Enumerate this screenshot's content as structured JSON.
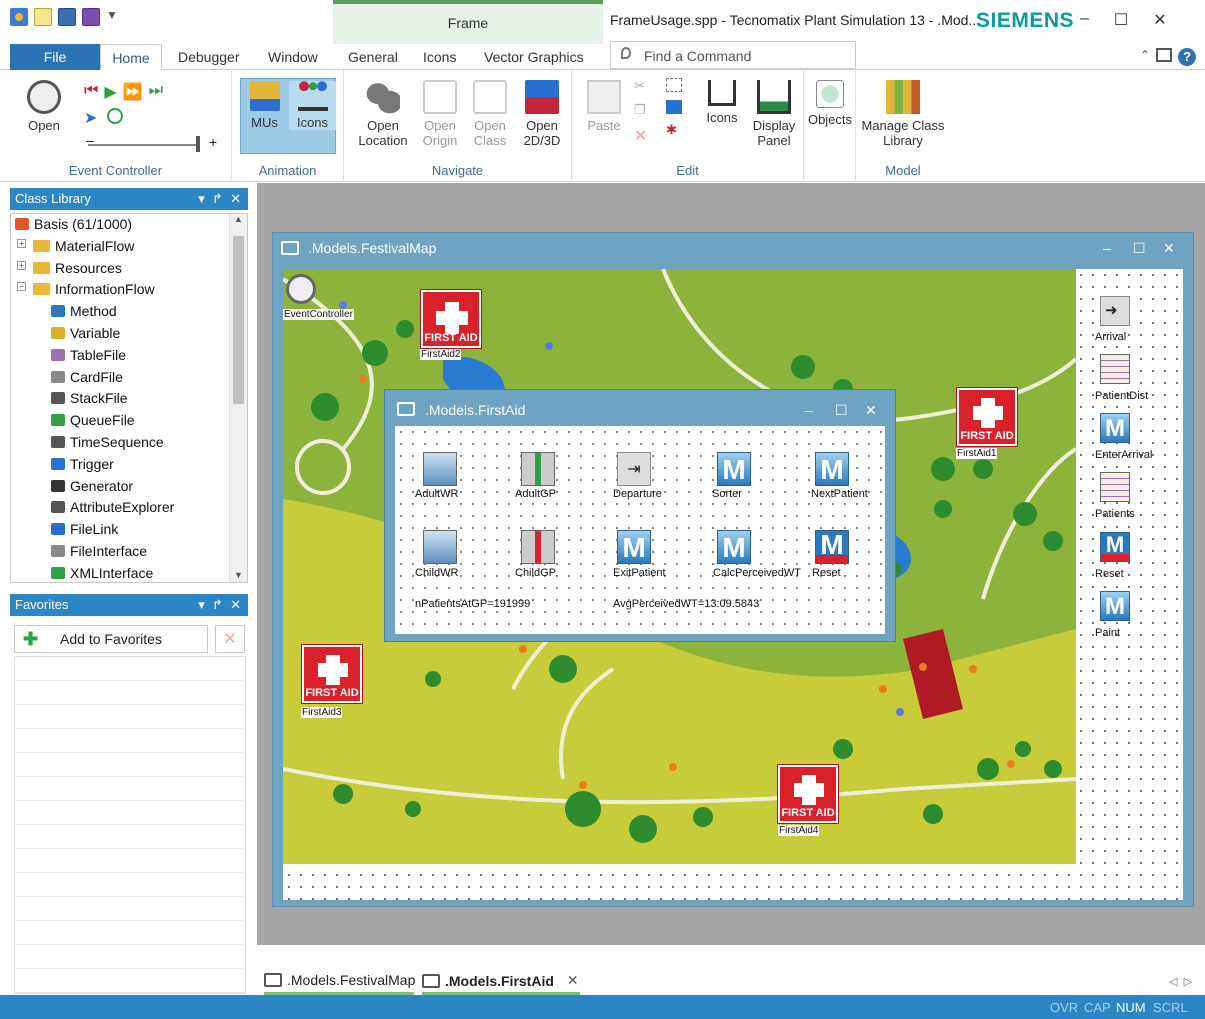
{
  "app": {
    "context_tab": "Frame",
    "window_title": "FrameUsage.spp - Tecnomatix Plant Simulation 13 - .Mod...",
    "brand": "SIEMENS"
  },
  "menu": {
    "file": "File",
    "tabs": [
      "Home",
      "Debugger",
      "Window",
      "General",
      "Icons",
      "Vector Graphics"
    ],
    "search_placeholder": "Find a Command"
  },
  "ribbon": {
    "event_controller": {
      "label": "Event Controller",
      "open": "Open"
    },
    "animation": {
      "label": "Animation",
      "mus": "MUs",
      "icons": "Icons"
    },
    "navigate": {
      "label": "Navigate",
      "open_location": "Open Location",
      "open_origin": "Open Origin",
      "open_class": "Open Class",
      "open_2d3d": "Open 2D/3D"
    },
    "edit": {
      "label": "Edit",
      "paste": "Paste",
      "icons": "Icons",
      "display_panel": "Display Panel",
      "objects": "Objects"
    },
    "model": {
      "label": "Model",
      "manage": "Manage Class Library"
    }
  },
  "class_library": {
    "title": "Class Library",
    "items": [
      {
        "label": "Basis (61/1000)",
        "level": 0,
        "icon": "basis-icon"
      },
      {
        "label": "MaterialFlow",
        "level": 1,
        "icon": "folder-icon"
      },
      {
        "label": "Resources",
        "level": 1,
        "icon": "folder-icon"
      },
      {
        "label": "InformationFlow",
        "level": 1,
        "icon": "folder-icon"
      },
      {
        "label": "Method",
        "level": 2,
        "icon": "method-icon"
      },
      {
        "label": "Variable",
        "level": 2,
        "icon": "variable-icon"
      },
      {
        "label": "TableFile",
        "level": 2,
        "icon": "table-icon"
      },
      {
        "label": "CardFile",
        "level": 2,
        "icon": "cardfile-icon"
      },
      {
        "label": "StackFile",
        "level": 2,
        "icon": "stack-icon"
      },
      {
        "label": "QueueFile",
        "level": 2,
        "icon": "queue-icon"
      },
      {
        "label": "TimeSequence",
        "level": 2,
        "icon": "timeseq-icon"
      },
      {
        "label": "Trigger",
        "level": 2,
        "icon": "trigger-icon"
      },
      {
        "label": "Generator",
        "level": 2,
        "icon": "generator-icon"
      },
      {
        "label": "AttributeExplorer",
        "level": 2,
        "icon": "explorer-icon"
      },
      {
        "label": "FileLink",
        "level": 2,
        "icon": "filelink-icon"
      },
      {
        "label": "FileInterface",
        "level": 2,
        "icon": "fileinterface-icon"
      },
      {
        "label": "XMLInterface",
        "level": 2,
        "icon": "xml-icon"
      }
    ]
  },
  "favorites": {
    "title": "Favorites",
    "add": "Add to Favorites"
  },
  "festival_map": {
    "title": ".Models.FestivalMap",
    "event_controller": "EventController",
    "first_aid_labels": [
      "FirstAid2",
      "FirstAid1",
      "FirstAid3",
      "FirstAid4"
    ],
    "first_aid_text": "FIRST AID",
    "side_objects": [
      "Arrival",
      "PatientDist",
      "EnterArrival",
      "Patients",
      "Reset",
      "Paint"
    ]
  },
  "first_aid_window": {
    "title": ".Models.FirstAid",
    "objects_row1": [
      "AdultWR",
      "AdultGP",
      "Departure",
      "Sorter",
      "NextPatient"
    ],
    "objects_row2": [
      "ChildWR",
      "ChildGP",
      "ExitPatient",
      "CalcPerceivedWT",
      "Reset"
    ],
    "var1": "nPatientsAtGP=191999",
    "var2": "AvgPerceivedWT=13:09.5843"
  },
  "doc_tabs": [
    ".Models.FestivalMap",
    ".Models.FirstAid"
  ],
  "status": [
    "OVR",
    "CAP",
    "NUM",
    "SCRL"
  ],
  "colors": {
    "accent": "#2c86c6",
    "brand": "#0a9aa4",
    "first_aid_red": "#d9212b",
    "map_green": "#8cb43c"
  }
}
